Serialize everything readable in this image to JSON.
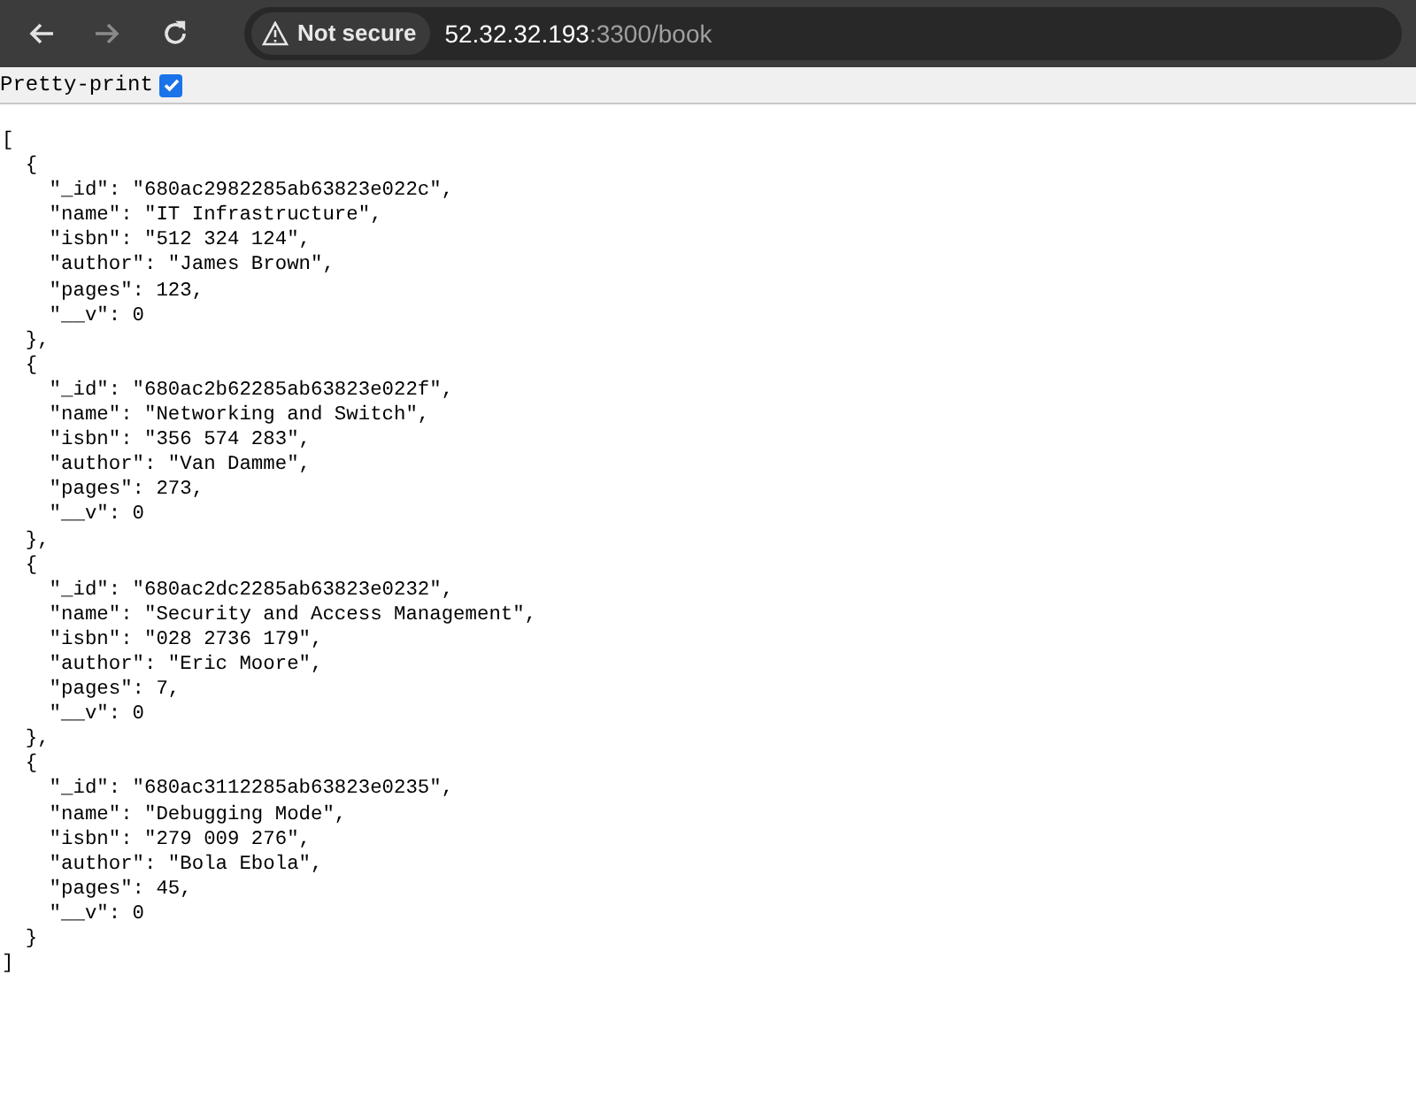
{
  "toolbar": {
    "buttons": [
      {
        "kind": "back",
        "disabled": false
      },
      {
        "kind": "forward",
        "disabled": true
      },
      {
        "kind": "reload",
        "disabled": false
      }
    ],
    "security": "Not secure",
    "url_host": "52.32.32.193",
    "url_rest": ":3300/book"
  },
  "pretty_print": {
    "label": "Pretty-print",
    "checked": true
  },
  "document": {
    "open": "[",
    "close": "]",
    "records": [
      {
        "open": "{",
        "close": "},",
        "fields": [
          "\"_id\": \"680ac2982285ab63823e022c\",",
          "\"name\": \"IT Infrastructure\",",
          "\"isbn\": \"512 324 124\",",
          "\"author\": \"James Brown\",",
          "\"pages\": 123,",
          "\"__v\": 0"
        ]
      },
      {
        "open": "{",
        "close": "},",
        "fields": [
          "\"_id\": \"680ac2b62285ab63823e022f\",",
          "\"name\": \"Networking and Switch\",",
          "\"isbn\": \"356 574 283\",",
          "\"author\": \"Van Damme\",",
          "\"pages\": 273,",
          "\"__v\": 0"
        ]
      },
      {
        "open": "{",
        "close": "},",
        "fields": [
          "\"_id\": \"680ac2dc2285ab63823e0232\",",
          "\"name\": \"Security and Access Management\",",
          "\"isbn\": \"028 2736 179\",",
          "\"author\": \"Eric Moore\",",
          "\"pages\": 7,",
          "\"__v\": 0"
        ]
      },
      {
        "open": "{",
        "close": "}",
        "fields": [
          "\"_id\": \"680ac3112285ab63823e0235\",",
          "\"name\": \"Debugging Mode\",",
          "\"isbn\": \"279 009 276\",",
          "\"author\": \"Bola Ebola\",",
          "\"pages\": 45,",
          "\"__v\": 0"
        ]
      }
    ]
  }
}
